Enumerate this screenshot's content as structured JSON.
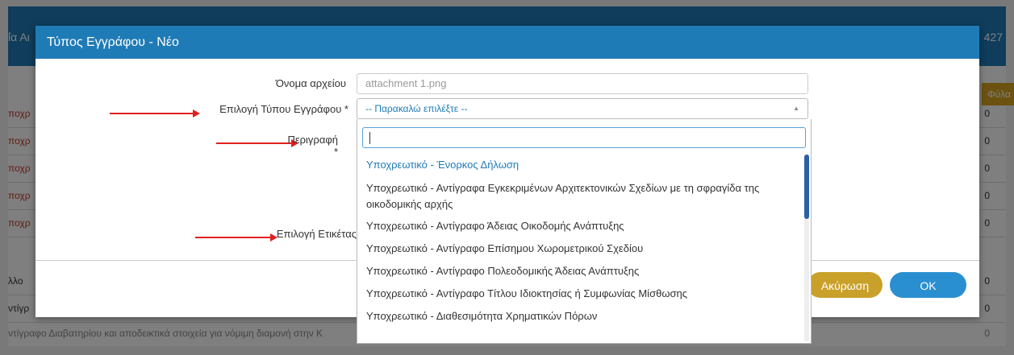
{
  "background": {
    "title_fragment": "ΐα Αι",
    "number_fragment": "427",
    "filter_label": "Φύλα",
    "rows": [
      {
        "text": "ποχρ",
        "count": "0"
      },
      {
        "text": "ποχρ",
        "count": "0"
      },
      {
        "text": "ποχρ",
        "count": "0"
      },
      {
        "text": "ποχρ",
        "count": "0"
      },
      {
        "text": "ποχρ",
        "count": "0"
      },
      {
        "text": "λλο",
        "count": "0"
      },
      {
        "text": "ντίγρ",
        "count": "0"
      }
    ],
    "bottom_text": "ντίγραφο Διαβατηρίου και αποδεικτικά στοιχεία για νόμιμη διαμονή στην Κ",
    "bottom_count": "0"
  },
  "modal": {
    "title": "Τύπος Εγγράφου - Νέο",
    "fields": {
      "filename_label": "Όνομα αρχείου",
      "filename_value": "attachment 1.png",
      "doctype_label": "Επιλογή Τύπου Εγγράφου *",
      "doctype_value": "-- Παρακαλώ επιλέξτε --",
      "description_label": "Περιγραφή *",
      "tag_label": "Επιλογή Ετικέτας"
    },
    "dropdown": {
      "search_value": "",
      "options": [
        "Υποχρεωτικό - Ένορκος Δήλωση",
        "Υποχρεωτικό - Αντίγραφα Εγκεκριμένων Αρχιτεκτονικών Σχεδίων με τη σφραγίδα της οικοδομικής αρχής",
        "Υποχρεωτικό - Αντίγραφο Άδειας Οικοδομής Ανάπτυξης",
        "Υποχρεωτικό - Αντίγραφο Επίσημου Χωρομετρικού Σχεδίου",
        "Υποχρεωτικό - Αντίγραφο Πολεοδομικής Άδειας Ανάπτυξης",
        "Υποχρεωτικό - Αντίγραφο Τίτλου Ιδιοκτησίας ή Συμφωνίας Μίσθωσης",
        "Υποχρεωτικό - Διαθεσιμότητα Χρηματικών Πόρων"
      ]
    },
    "buttons": {
      "cancel": "Ακύρωση",
      "ok": "OK"
    }
  },
  "colors": {
    "header_blue": "#1f7bb6",
    "cancel_gold": "#c9a12a",
    "ok_blue": "#2a8fd0",
    "arrow_red": "#e02020"
  }
}
